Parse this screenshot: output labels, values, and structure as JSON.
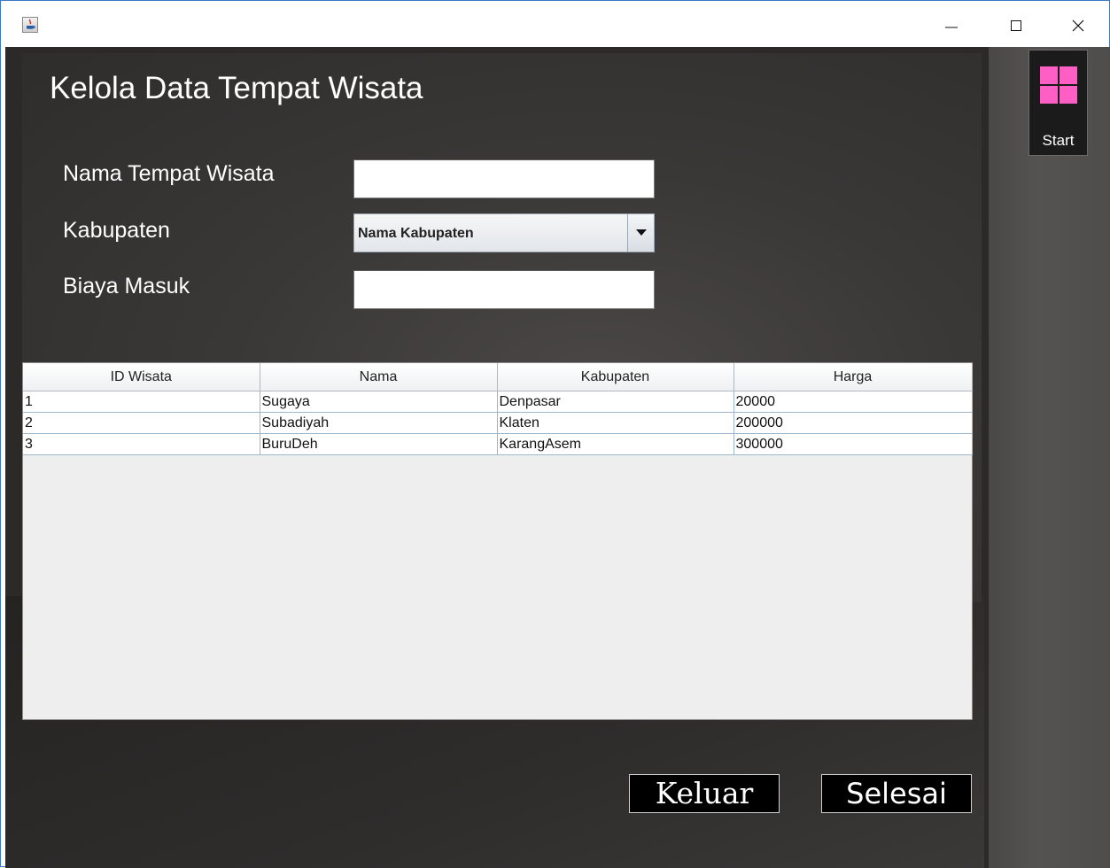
{
  "window": {
    "minimize_glyph": "—",
    "icons": {
      "app": "java-app-icon",
      "minimize": "minimize-icon",
      "maximize": "maximize-icon",
      "close": "close-icon"
    }
  },
  "page": {
    "title": "Kelola Data Tempat Wisata"
  },
  "form": {
    "nama_label": "Nama Tempat Wisata",
    "nama_value": "",
    "kabupaten_label": "Kabupaten",
    "kabupaten_selected": "Nama Kabupaten",
    "biaya_label": "Biaya Masuk",
    "biaya_value": ""
  },
  "table": {
    "columns": [
      "ID Wisata",
      "Nama",
      "Kabupaten",
      "Harga"
    ],
    "rows": [
      [
        "1",
        "Sugaya",
        "Denpasar",
        "20000"
      ],
      [
        "2",
        "Subadiyah",
        "Klaten",
        "200000"
      ],
      [
        "3",
        "BuruDeh",
        "KarangAsem",
        "300000"
      ]
    ]
  },
  "buttons": {
    "keluar": "Keluar",
    "selesai": "Selesai"
  },
  "sidebar": {
    "start_label": "Start",
    "start_icon": "windows-logo-icon",
    "start_color": "#ff5fc4"
  },
  "colors": {
    "background": "#2c2a29",
    "table_bg": "#eeeeee",
    "accent_border": "#3b78c4"
  }
}
